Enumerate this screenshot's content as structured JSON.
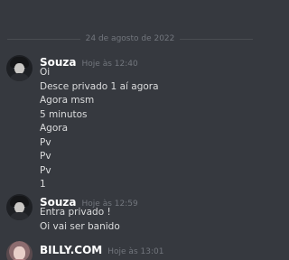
{
  "divider": {
    "date": "24 de agosto de 2022"
  },
  "groups": [
    {
      "author": "Souza",
      "time": "Hoje às 12:40",
      "messages": [
        "Oi",
        "Desce privado 1 aí agora",
        "Agora msm",
        "5 minutos",
        "Agora",
        "Pv",
        "Pv",
        "Pv",
        "1"
      ]
    },
    {
      "author": "Souza",
      "time": "Hoje às 12:59",
      "messages": [
        "Entra privado !",
        "Oi vai ser banido"
      ]
    },
    {
      "author": "BILLY.COM",
      "time": "Hoje às 13:01",
      "messages": []
    }
  ]
}
